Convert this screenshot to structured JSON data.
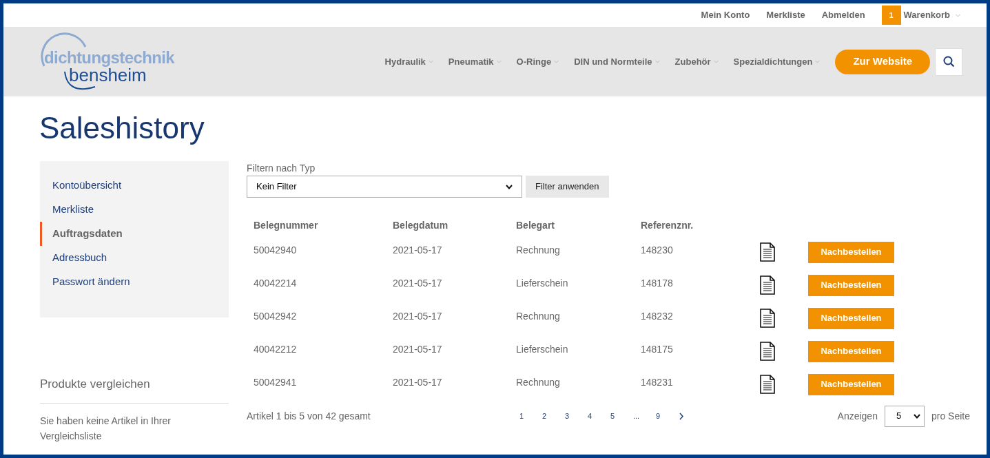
{
  "top_links": [
    "Mein Konto",
    "Merkliste",
    "Abmelden"
  ],
  "cart": {
    "count": "1",
    "label": "Warenkorb"
  },
  "logo": {
    "line1": "dichtungstechnik",
    "line2": "bensheim"
  },
  "nav": [
    "Hydraulik",
    "Pneumatik",
    "O-Ringe",
    "DIN und Normteile",
    "Zubehör",
    "Spezialdichtungen"
  ],
  "website_button": "Zur Website",
  "title": "Saleshistory",
  "sidebar": {
    "items": [
      {
        "label": "Kontoübersicht",
        "selected": false
      },
      {
        "label": "Merkliste",
        "selected": false
      },
      {
        "label": "Auftragsdaten",
        "selected": true
      },
      {
        "label": "Adressbuch",
        "selected": false
      },
      {
        "label": "Passwort ändern",
        "selected": false
      }
    ]
  },
  "compare": {
    "title": "Produkte vergleichen",
    "text": "Sie haben keine Artikel in Ihrer Vergleichsliste"
  },
  "filter": {
    "label": "Filtern nach Typ",
    "value": "Kein Filter",
    "button": "Filter anwenden"
  },
  "table": {
    "columns": [
      "Belegnummer",
      "Belegdatum",
      "Belegart",
      "Referenznr."
    ],
    "rows": [
      {
        "cells": [
          "50042940",
          "2021-05-17",
          "Rechnung",
          "148230"
        ],
        "action": "Nachbestellen"
      },
      {
        "cells": [
          "40042214",
          "2021-05-17",
          "Lieferschein",
          "148178"
        ],
        "action": "Nachbestellen"
      },
      {
        "cells": [
          "50042942",
          "2021-05-17",
          "Rechnung",
          "148232"
        ],
        "action": "Nachbestellen"
      },
      {
        "cells": [
          "40042212",
          "2021-05-17",
          "Lieferschein",
          "148175"
        ],
        "action": "Nachbestellen"
      },
      {
        "cells": [
          "50042941",
          "2021-05-17",
          "Rechnung",
          "148231"
        ],
        "action": "Nachbestellen"
      }
    ]
  },
  "pager": {
    "summary": "Artikel 1 bis 5 von 42 gesamt",
    "pages": [
      "1",
      "2",
      "3",
      "4",
      "5",
      "...",
      "9"
    ],
    "per_page_label": "Anzeigen",
    "per_page": "5",
    "per_page_suffix": "pro Seite"
  }
}
